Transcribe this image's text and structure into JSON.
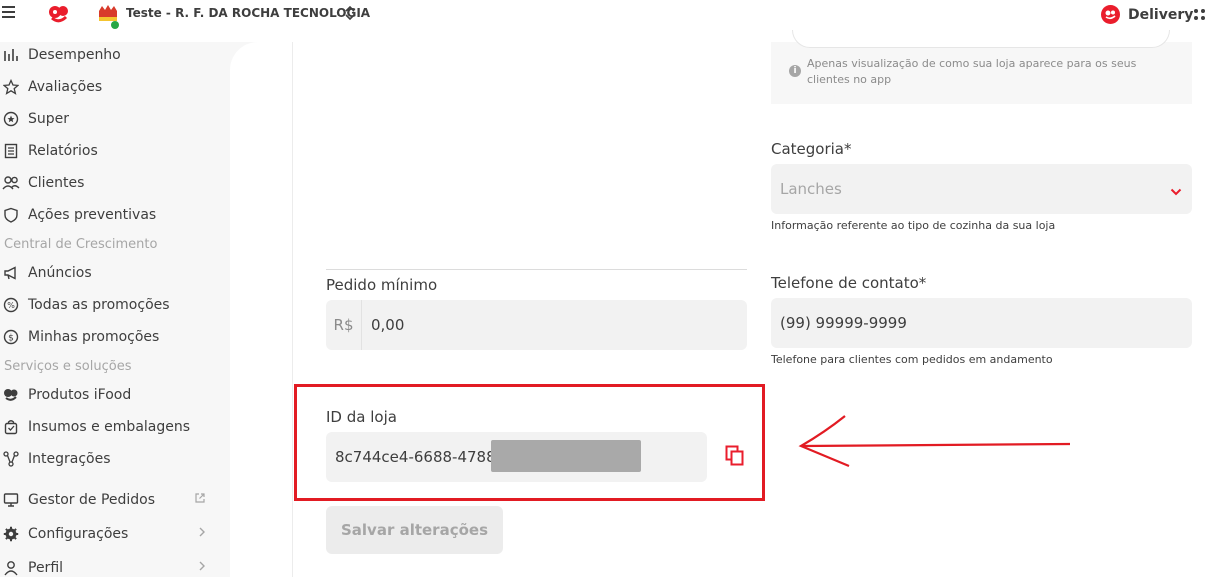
{
  "topbar": {
    "store_name": "Teste - R. F. DA ROCHA TECNOLOGIA",
    "delivery_label": "Delivery"
  },
  "sidebar": {
    "items": [
      {
        "label": "Desempenho",
        "icon": "bar-chart-icon"
      },
      {
        "label": "Avaliações",
        "icon": "star-icon"
      },
      {
        "label": "Super",
        "icon": "star-circle-icon"
      },
      {
        "label": "Relatórios",
        "icon": "report-icon"
      },
      {
        "label": "Clientes",
        "icon": "users-icon"
      },
      {
        "label": "Ações preventivas",
        "icon": "shield-icon"
      }
    ],
    "section_growth": "Central de Crescimento",
    "growth_items": [
      {
        "label": "Anúncios",
        "icon": "megaphone-icon"
      },
      {
        "label": "Todas as promoções",
        "icon": "percent-icon"
      },
      {
        "label": "Minhas promoções",
        "icon": "dollar-icon"
      }
    ],
    "section_services": "Serviços e soluções",
    "service_items": [
      {
        "label": "Produtos iFood",
        "icon": "ifood-icon"
      },
      {
        "label": "Insumos e embalagens",
        "icon": "bag-icon"
      },
      {
        "label": "Integrações",
        "icon": "integration-icon"
      }
    ],
    "bottom_items": [
      {
        "label": "Gestor de Pedidos",
        "icon": "monitor-icon"
      },
      {
        "label": "Configurações",
        "icon": "gear-icon"
      },
      {
        "label": "Perfil",
        "icon": "person-icon"
      }
    ]
  },
  "form": {
    "preview_note": "Apenas visualização de como sua loja aparece para os seus clientes no app",
    "category_label": "Categoria*",
    "category_value": "Lanches",
    "category_help": "Informação referente ao tipo de cozinha da sua loja",
    "min_order_label": "Pedido mínimo",
    "min_order_prefix": "R$",
    "min_order_value": "0,00",
    "phone_label": "Telefone de contato*",
    "phone_value": "(99) 99999-9999",
    "phone_help": "Telefone para clientes com pedidos em andamento",
    "store_id_label": "ID da loja",
    "store_id_value": "8c744ce4-6688-4788",
    "save_label": "Salvar alterações"
  },
  "colors": {
    "brand_red": "#ea1d2c",
    "annotation_red": "#e21b23",
    "text": "#3e3e3e",
    "muted": "#a6a6a6"
  }
}
